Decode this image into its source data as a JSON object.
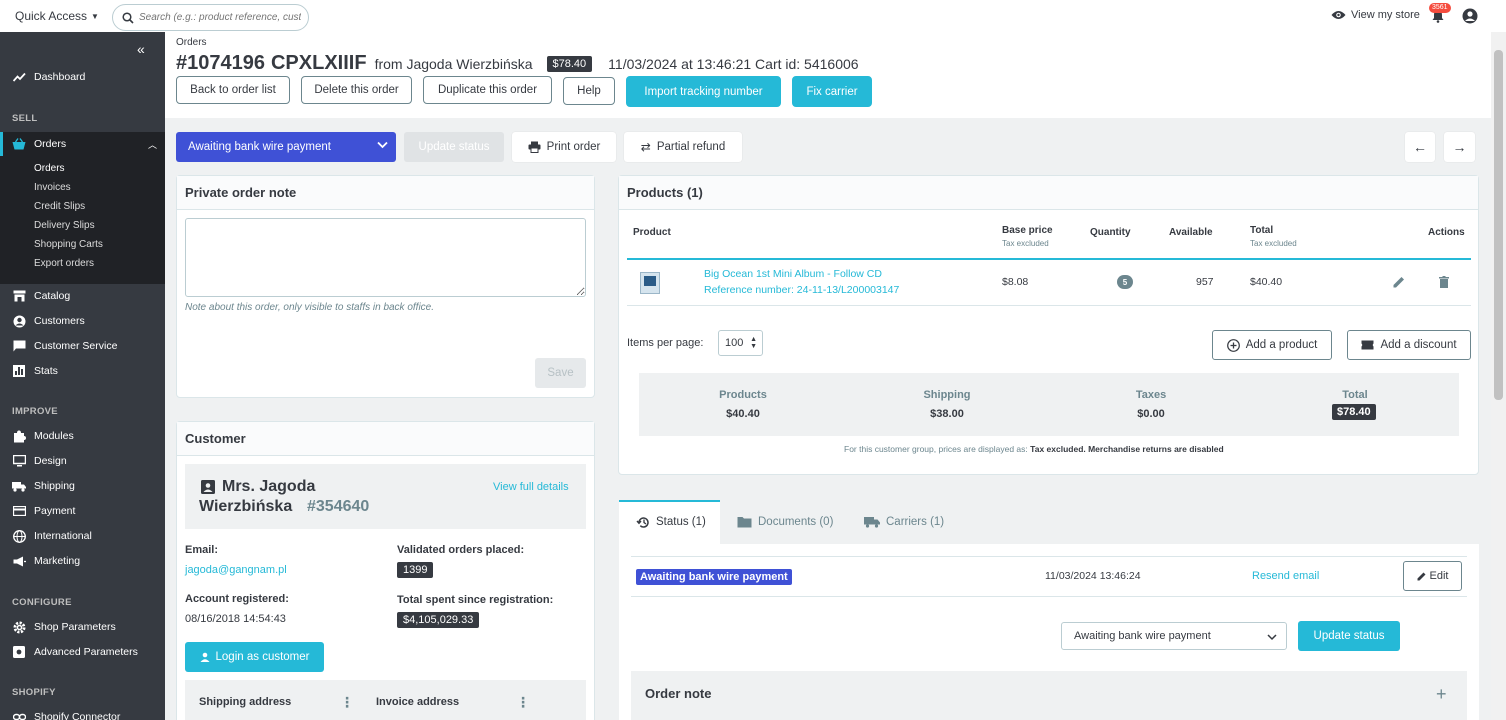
{
  "topbar": {
    "quick_access": "Quick Access",
    "search_placeholder": "Search (e.g.: product reference, custon",
    "view_store": "View my store",
    "notifications_count": "3561"
  },
  "sidebar": {
    "dashboard": "Dashboard",
    "sell_section": "SELL",
    "orders": "Orders",
    "sub_orders": [
      "Orders",
      "Invoices",
      "Credit Slips",
      "Delivery Slips",
      "Shopping Carts",
      "Export orders"
    ],
    "catalog": "Catalog",
    "customers": "Customers",
    "customer_service": "Customer Service",
    "stats": "Stats",
    "improve_section": "IMPROVE",
    "modules": "Modules",
    "design": "Design",
    "shipping": "Shipping",
    "payment": "Payment",
    "international": "International",
    "marketing": "Marketing",
    "configure_section": "CONFIGURE",
    "shop_parameters": "Shop Parameters",
    "advanced_parameters": "Advanced Parameters",
    "shopify_section": "SHOPIFY",
    "shopify_connector": "Shopify Connector"
  },
  "header": {
    "breadcrumb": "Orders",
    "order_number": "#1074196",
    "order_reference": "CPXLXIIIF",
    "from": "from Jagoda Wierzbińska",
    "total_badge": "$78.40",
    "date_cart": "11/03/2024 at 13:46:21 Cart id: 5416006",
    "buttons": {
      "back": "Back to order list",
      "delete": "Delete this order",
      "duplicate": "Duplicate this order",
      "help": "Help",
      "import_tracking": "Import tracking number",
      "fix_carrier": "Fix carrier"
    }
  },
  "actionbar": {
    "status_select": "Awaiting bank wire payment",
    "update_status": "Update status",
    "print_order": "Print order",
    "partial_refund": "Partial refund"
  },
  "private_note": {
    "title": "Private order note",
    "help": "Note about this order, only visible to staffs in back office.",
    "save": "Save"
  },
  "customer": {
    "title": "Customer",
    "name_line1": "Mrs. Jagoda",
    "name_line2": "Wierzbińska",
    "customer_id": "#354640",
    "view_details": "View full details",
    "email_label": "Email:",
    "email": "jagoda@gangnam.pl",
    "validated_label": "Validated orders placed:",
    "validated_count": "1399",
    "registered_label": "Account registered:",
    "registered_date": "08/16/2018 14:54:43",
    "spent_label": "Total spent since registration:",
    "spent_value": "$4,105,029.33",
    "login_button": "Login as customer",
    "shipping_address": "Shipping address",
    "invoice_address": "Invoice address"
  },
  "products": {
    "title": "Products (1)",
    "col_product": "Product",
    "col_base_price": "Base price",
    "col_base_price_sub": "Tax excluded",
    "col_quantity": "Quantity",
    "col_available": "Available",
    "col_total": "Total",
    "col_total_sub": "Tax excluded",
    "col_actions": "Actions",
    "rows": [
      {
        "name": "Big Ocean 1st Mini Album - Follow CD",
        "reference": "Reference number: 24-11-13/L200003147",
        "base_price": "$8.08",
        "quantity": "5",
        "available": "957",
        "total": "$40.40"
      }
    ],
    "items_per_page_label": "Items per page:",
    "items_per_page": "100",
    "add_product": "Add a product",
    "add_discount": "Add a discount",
    "totals": {
      "products_label": "Products",
      "products_value": "$40.40",
      "shipping_label": "Shipping",
      "shipping_value": "$38.00",
      "taxes_label": "Taxes",
      "taxes_value": "$0.00",
      "total_label": "Total",
      "total_value": "$78.40"
    },
    "footnote_prefix": "For this customer group, prices are displayed as:",
    "footnote_bold": "Tax excluded. Merchandise returns are disabled"
  },
  "status_tabs": {
    "status": "Status (1)",
    "documents": "Documents (0)",
    "carriers": "Carriers (1)"
  },
  "status_history": {
    "status": "Awaiting bank wire payment",
    "date": "11/03/2024 13:46:24",
    "resend": "Resend email",
    "edit": "Edit",
    "select_value": "Awaiting bank wire payment",
    "update_button": "Update status",
    "order_note": "Order note"
  },
  "colors": {
    "accent": "#25b9d7",
    "status_blue": "#3f51d6",
    "sidebar": "#363a41"
  }
}
